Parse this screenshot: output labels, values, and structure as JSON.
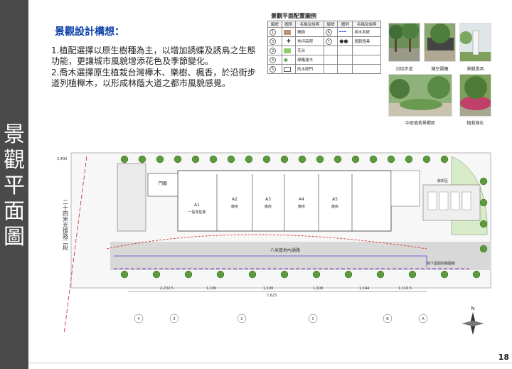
{
  "side_title": [
    "景",
    "觀",
    "平",
    "面",
    "圖"
  ],
  "concept": {
    "heading": "景觀設計構想：",
    "items": [
      "1.植配選擇以原生樹種為主，以增加誘蝶及誘鳥之生態功能，更讓城市風貌增添花色及季節變化。",
      "2.喬木選擇原生植栽台灣櫸木、樂樹、楓香，於沿街步道列植櫸木，以形成林蔭大道之都市風貌感覺。"
    ]
  },
  "legend": {
    "title": "景觀平面配置圖例",
    "headers": [
      "編號",
      "圖例",
      "名稱及說明",
      "編號",
      "圖例",
      "名稱及說明"
    ],
    "rows": [
      {
        "left_no": "1",
        "left_name": "鋪面",
        "right_no": "6",
        "right_name": "排水系統"
      },
      {
        "left_no": "3",
        "left_name": "地坪高程",
        "right_no": "7",
        "right_name": "景觀燈具"
      },
      {
        "left_no": "3",
        "left_name": "花台",
        "right_no": "",
        "right_name": ""
      },
      {
        "left_no": "4",
        "left_name": "綠籬灌木",
        "right_no": "",
        "right_name": ""
      },
      {
        "left_no": "5",
        "left_name": "防水閘門",
        "right_no": "",
        "right_name": ""
      }
    ],
    "colors": {
      "paving": "#b8957a",
      "planter": "#8fcf6a"
    }
  },
  "photos": {
    "captions": [
      "沿街步道",
      "鋪空圍籬",
      "景觀燈具",
      "中庭植栽景觀區",
      "植栽綠化"
    ]
  },
  "plan": {
    "units": [
      {
        "id": "A1",
        "label": "一般零售業"
      },
      {
        "id": "A2",
        "label": "廠房"
      },
      {
        "id": "A3",
        "label": "廠房"
      },
      {
        "id": "A4",
        "label": "廠房"
      },
      {
        "id": "A5",
        "label": "廠房"
      }
    ],
    "gate_label": "門廳",
    "road_label": "二十四米光復路二段",
    "fire_lane_label": "八米基地內通路",
    "parking_label": "地下室開挖範圍線",
    "parking_area_label": "裝卸區",
    "dimension_labels": [
      "2,400",
      "2,232.5",
      "1,100",
      "1,100",
      "1,100",
      "1,144",
      "1,116.5",
      "7,625"
    ],
    "grid_numbers": [
      "4",
      "3",
      "2",
      "1",
      "B",
      "A"
    ]
  },
  "page_number": "18"
}
